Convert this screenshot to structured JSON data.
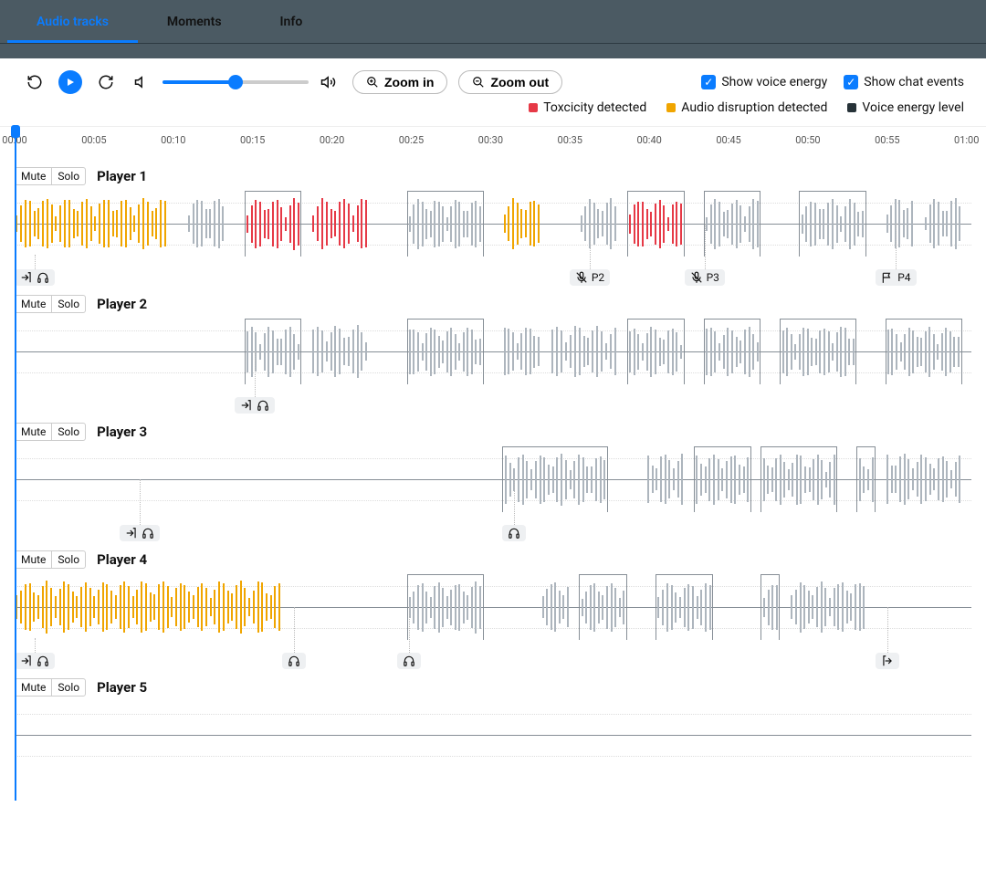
{
  "tabs": [
    {
      "label": "Audio tracks",
      "active": true
    },
    {
      "label": "Moments",
      "active": false
    },
    {
      "label": "Info",
      "active": false
    }
  ],
  "toolbar": {
    "zoom_in": "Zoom in",
    "zoom_out": "Zoom out",
    "checkboxes": [
      {
        "label": "Show voice energy",
        "checked": true
      },
      {
        "label": "Show chat events",
        "checked": true
      }
    ],
    "volume": 50
  },
  "legend": [
    {
      "label": "Toxcicity detected",
      "color": "#e63946"
    },
    {
      "label": "Audio disruption detected",
      "color": "#f0a500"
    },
    {
      "label": "Voice energy level",
      "color": "#263238"
    }
  ],
  "time_ticks": [
    "00:00",
    "00:05",
    "00:10",
    "00:15",
    "00:20",
    "00:25",
    "00:30",
    "00:35",
    "00:40",
    "00:45",
    "00:50",
    "00:55",
    "01:00"
  ],
  "colors": {
    "red": "#e63946",
    "orange": "#f0a500",
    "gray": "#adb5bd"
  },
  "buttons": {
    "mute": "Mute",
    "solo": "Solo"
  },
  "tracks": [
    {
      "name": "Player 1",
      "segments": [
        {
          "start": 0,
          "end": 16,
          "color": "orange",
          "boxed": false
        },
        {
          "start": 18,
          "end": 22,
          "color": "gray",
          "boxed": false
        },
        {
          "start": 24,
          "end": 30,
          "color": "red",
          "boxed": true
        },
        {
          "start": 31,
          "end": 37,
          "color": "red",
          "boxed": false
        },
        {
          "start": 41,
          "end": 49,
          "color": "gray",
          "boxed": true
        },
        {
          "start": 51,
          "end": 55,
          "color": "orange",
          "boxed": false
        },
        {
          "start": 59,
          "end": 63,
          "color": "gray",
          "boxed": false
        },
        {
          "start": 64,
          "end": 70,
          "color": "red",
          "boxed": true
        },
        {
          "start": 72,
          "end": 78,
          "color": "gray",
          "boxed": true
        },
        {
          "start": 82,
          "end": 89,
          "color": "gray",
          "boxed": true
        },
        {
          "start": 91,
          "end": 94,
          "color": "gray",
          "boxed": false
        },
        {
          "start": 95,
          "end": 99,
          "color": "gray",
          "boxed": false
        }
      ],
      "events": [
        {
          "pos": 0,
          "icons": [
            "enter",
            "headphones"
          ],
          "label": ""
        },
        {
          "pos": 58,
          "icons": [
            "mic-off"
          ],
          "label": "P2"
        },
        {
          "pos": 70,
          "icons": [
            "mic-off"
          ],
          "label": "P3"
        },
        {
          "pos": 90,
          "icons": [
            "flag"
          ],
          "label": "P4"
        }
      ]
    },
    {
      "name": "Player 2",
      "segments": [
        {
          "start": 24,
          "end": 30,
          "color": "gray",
          "boxed": true
        },
        {
          "start": 31,
          "end": 37,
          "color": "gray",
          "boxed": false
        },
        {
          "start": 41,
          "end": 49,
          "color": "gray",
          "boxed": true
        },
        {
          "start": 51,
          "end": 55,
          "color": "gray",
          "boxed": false
        },
        {
          "start": 56,
          "end": 63,
          "color": "gray",
          "boxed": false
        },
        {
          "start": 64,
          "end": 70,
          "color": "gray",
          "boxed": true
        },
        {
          "start": 72,
          "end": 78,
          "color": "gray",
          "boxed": true
        },
        {
          "start": 80,
          "end": 88,
          "color": "gray",
          "boxed": true
        },
        {
          "start": 91,
          "end": 99,
          "color": "gray",
          "boxed": true
        }
      ],
      "events": [
        {
          "pos": 23,
          "icons": [
            "enter",
            "headphones"
          ],
          "label": ""
        }
      ]
    },
    {
      "name": "Player 3",
      "segments": [
        {
          "start": 51,
          "end": 62,
          "color": "gray",
          "boxed": true
        },
        {
          "start": 66,
          "end": 70,
          "color": "gray",
          "boxed": false
        },
        {
          "start": 71,
          "end": 77,
          "color": "gray",
          "boxed": true
        },
        {
          "start": 78,
          "end": 86,
          "color": "gray",
          "boxed": true
        },
        {
          "start": 88,
          "end": 90,
          "color": "gray",
          "boxed": true
        },
        {
          "start": 91,
          "end": 99,
          "color": "gray",
          "boxed": false
        }
      ],
      "events": [
        {
          "pos": 11,
          "icons": [
            "enter",
            "headphones"
          ],
          "label": ""
        },
        {
          "pos": 51,
          "icons": [
            "headphones"
          ],
          "label": ""
        }
      ]
    },
    {
      "name": "Player 4",
      "segments": [
        {
          "start": 0,
          "end": 28,
          "color": "orange",
          "boxed": false
        },
        {
          "start": 41,
          "end": 49,
          "color": "gray",
          "boxed": true
        },
        {
          "start": 55,
          "end": 58,
          "color": "gray",
          "boxed": false
        },
        {
          "start": 59,
          "end": 64,
          "color": "gray",
          "boxed": true
        },
        {
          "start": 67,
          "end": 73,
          "color": "gray",
          "boxed": true
        },
        {
          "start": 78,
          "end": 80,
          "color": "gray",
          "boxed": true
        },
        {
          "start": 81,
          "end": 89,
          "color": "gray",
          "boxed": false
        }
      ],
      "events": [
        {
          "pos": 0,
          "icons": [
            "enter",
            "headphones"
          ],
          "label": ""
        },
        {
          "pos": 28,
          "icons": [
            "headphones"
          ],
          "label": ""
        },
        {
          "pos": 40,
          "icons": [
            "headphones"
          ],
          "label": ""
        },
        {
          "pos": 90,
          "icons": [
            "exit"
          ],
          "label": ""
        }
      ]
    },
    {
      "name": "Player 5",
      "segments": [],
      "events": []
    }
  ]
}
